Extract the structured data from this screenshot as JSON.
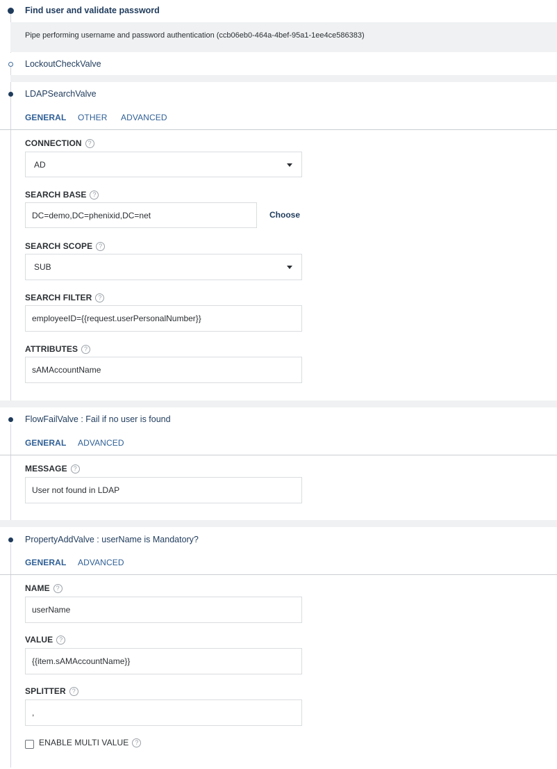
{
  "pipe": {
    "title": "Find user and validate password",
    "subtitle": "Pipe performing username and password authentication (ccb06eb0-464a-4bef-95a1-1ee4ce586383)"
  },
  "lockout_valve": {
    "title": "LockoutCheckValve"
  },
  "ldap_valve": {
    "title": "LDAPSearchValve",
    "tabs": [
      "GENERAL",
      "OTHER",
      "ADVANCED"
    ],
    "connection": {
      "label": "CONNECTION",
      "value": "AD"
    },
    "search_base": {
      "label": "SEARCH BASE",
      "value": "DC=demo,DC=phenixid,DC=net",
      "choose_label": "Choose"
    },
    "search_scope": {
      "label": "SEARCH SCOPE",
      "value": "SUB"
    },
    "search_filter": {
      "label": "SEARCH FILTER",
      "value": "employeeID={{request.userPersonalNumber}}"
    },
    "attributes": {
      "label": "ATTRIBUTES",
      "value": "sAMAccountName"
    }
  },
  "flowfail_valve": {
    "title": "FlowFailValve : Fail if no user is found",
    "tabs": [
      "GENERAL",
      "ADVANCED"
    ],
    "message": {
      "label": "MESSAGE",
      "value": "User not found in LDAP"
    }
  },
  "propertyadd_valve": {
    "title": "PropertyAddValve : userName is Mandatory?",
    "tabs": [
      "GENERAL",
      "ADVANCED"
    ],
    "name": {
      "label": "NAME",
      "value": "userName"
    },
    "value": {
      "label": "VALUE",
      "value": "{{item.sAMAccountName}}"
    },
    "splitter": {
      "label": "SPLITTER",
      "value": ","
    },
    "multi_value": {
      "label": "ENABLE MULTI VALUE",
      "checked": false
    }
  },
  "icons": {
    "help": "help-circle-icon",
    "dropdown": "chevron-down-icon",
    "timeline": "timeline-dot-icon"
  },
  "colors": {
    "accent": "#1f3b5c",
    "link": "#2f5f96",
    "band": "#eff1f2"
  }
}
